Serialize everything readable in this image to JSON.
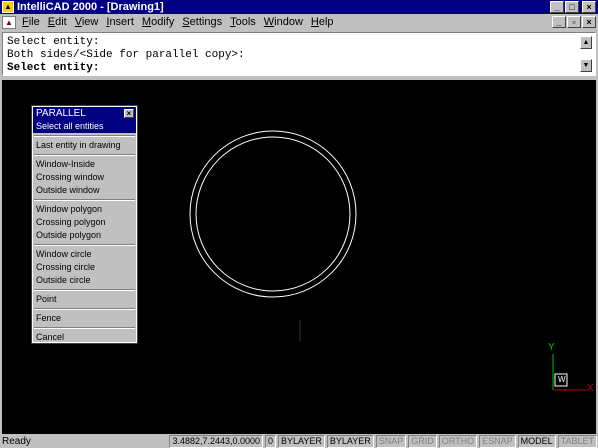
{
  "titlebar": {
    "title": "IntelliCAD 2000 - [Drawing1]",
    "minimize_glyph": "_",
    "maximize_glyph": "□",
    "close_glyph": "×"
  },
  "menubar": {
    "items": [
      "File",
      "Edit",
      "View",
      "Insert",
      "Modify",
      "Settings",
      "Tools",
      "Window",
      "Help"
    ],
    "minimize_glyph": "_",
    "restore_glyph": "▫",
    "close_glyph": "×"
  },
  "command": {
    "lines": [
      "Select entity:",
      "Both sides/<Side for parallel copy>:",
      "Select entity:"
    ],
    "scroll_up": "▲",
    "scroll_down": "▼"
  },
  "parallel_panel": {
    "title": "PARALLEL",
    "close_glyph": "×",
    "groups": [
      [
        "Select all entities"
      ],
      [
        "Last entity in drawing"
      ],
      [
        "Window-Inside",
        "Crossing window",
        "Outside window"
      ],
      [
        "Window polygon",
        "Crossing polygon",
        "Outside polygon"
      ],
      [
        "Window circle",
        "Crossing circle",
        "Outside circle"
      ],
      [
        "Point"
      ],
      [
        "Fence"
      ],
      [
        "Cancel"
      ]
    ],
    "selected": "Select all entities"
  },
  "ucs": {
    "y_label": "Y",
    "x_label": "X",
    "w_label": "W",
    "y_color": "#00c000",
    "x_color": "#c00000"
  },
  "statusbar": {
    "status": "Ready",
    "coords": "3.4882,7.2443,0.0000",
    "fields": [
      {
        "text": "0",
        "active": true
      },
      {
        "text": "BYLAYER",
        "active": true
      },
      {
        "text": "BYLAYER",
        "active": true
      },
      {
        "text": "SNAP",
        "active": false
      },
      {
        "text": "GRID",
        "active": false
      },
      {
        "text": "ORTHO",
        "active": false
      },
      {
        "text": "ESNAP",
        "active": false
      },
      {
        "text": "MODEL",
        "active": true
      },
      {
        "text": "TABLET",
        "active": false
      }
    ]
  },
  "colors": {
    "titlebar": "#000080",
    "canvas": "#000000",
    "entity": "#ffffff",
    "face": "#c0c0c0"
  }
}
